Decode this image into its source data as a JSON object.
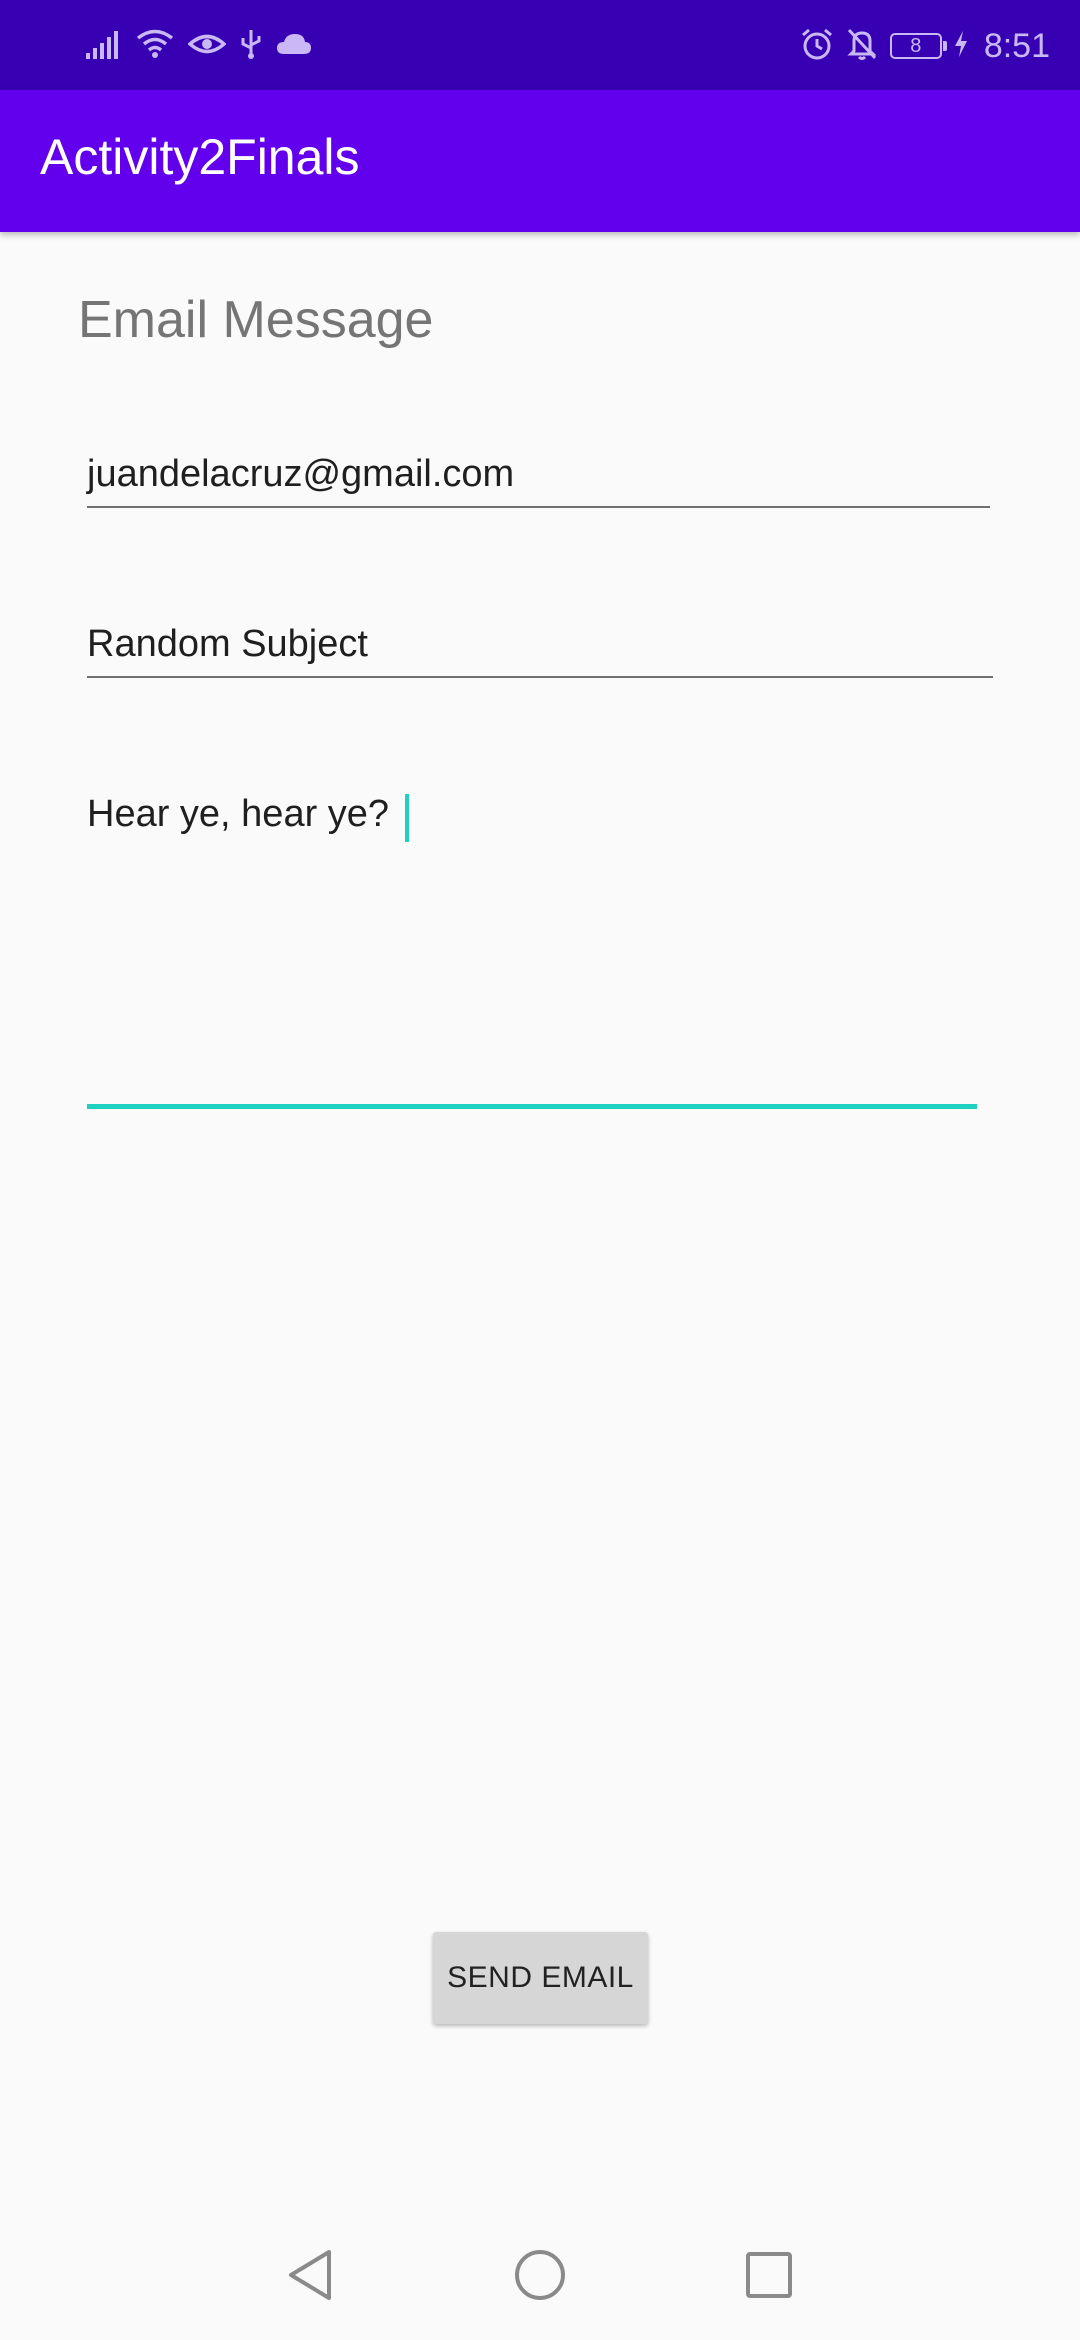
{
  "status_bar": {
    "time": "8:51",
    "battery_level": "8",
    "left_icons": [
      "signal-icon",
      "wifi-icon",
      "eye-icon",
      "usb-icon",
      "cloud-icon"
    ],
    "right_icons": [
      "alarm-icon",
      "notifications-off-icon",
      "battery-icon",
      "charging-icon"
    ]
  },
  "app_bar": {
    "title": "Activity2Finals"
  },
  "form": {
    "heading": "Email Message",
    "to_value": "juandelacruz@gmail.com",
    "subject_value": "Random Subject",
    "message_value": "Hear ye, hear ye?"
  },
  "actions": {
    "send_label": "SEND EMAIL"
  },
  "nav_bar": {
    "buttons": [
      "back-icon",
      "home-icon",
      "recents-icon"
    ]
  },
  "colors": {
    "status_bar": "#3700b3",
    "app_bar": "#6200ee",
    "accent": "#1fcfc0",
    "background": "#fafafa",
    "button": "#d6d6d6"
  }
}
